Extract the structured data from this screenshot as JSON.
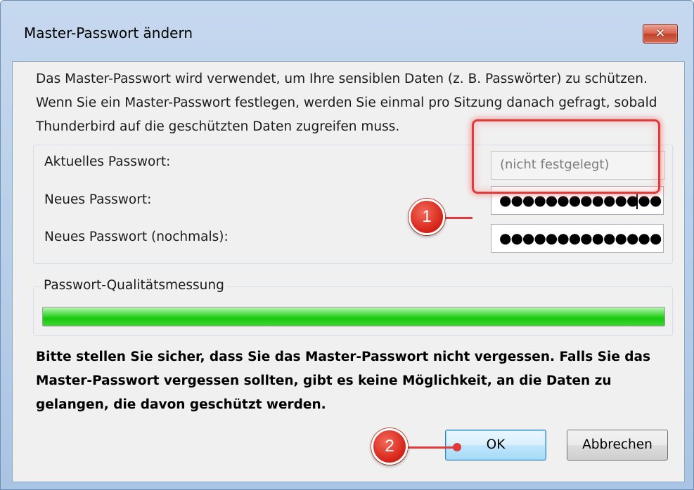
{
  "window": {
    "title": "Master-Passwort ändern",
    "close_icon": "close-icon",
    "close_label": "✕"
  },
  "intro_text": "Das Master-Passwort wird verwendet, um Ihre sensiblen Daten (z. B. Passwörter) zu schützen. Wenn Sie ein Master-Passwort festlegen, werden Sie einmal pro Sitzung danach gefragt, sobald Thunderbird auf die geschützten Daten zugreifen muss.",
  "fields": {
    "current": {
      "label": "Aktuelles Passwort:",
      "value": "(nicht festgelegt)"
    },
    "new": {
      "label": "Neues Passwort:",
      "masked_value": "●●●●●●●●●●●●●●"
    },
    "confirm": {
      "label": "Neues Passwort (nochmals):",
      "masked_value": "●●●●●●●●●●●●●●"
    }
  },
  "quality": {
    "legend": "Passwort-Qualitätsmessung",
    "level_percent": 100,
    "bar_color": "#18c80c"
  },
  "warning_text": "Bitte stellen Sie sicher, dass Sie das Master-Passwort nicht vergessen. Falls Sie das Master-Passwort vergessen sollten, gibt es keine Möglichkeit, an die Daten zu gelangen, die davon geschützt werden.",
  "buttons": {
    "ok": "OK",
    "cancel": "Abbrechen"
  },
  "annotations": {
    "marker1": "1",
    "marker2": "2",
    "color": "#e03b3b"
  }
}
